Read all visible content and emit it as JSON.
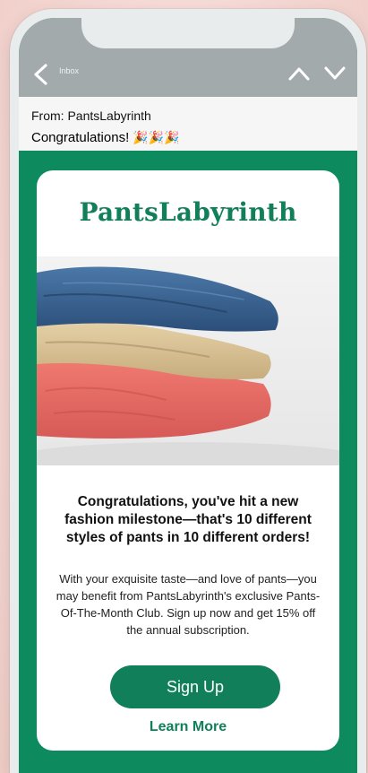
{
  "app": {
    "topbar": {
      "inbox_label": "Inbox"
    },
    "icons": {
      "back": "chevron-left-icon",
      "prev": "chevron-up-icon",
      "next": "chevron-down-icon"
    }
  },
  "email": {
    "from": "From: PantsLabyrinth",
    "subject": "Congratulations!",
    "subject_emoji": "🎉🎉🎉"
  },
  "content": {
    "brand": "PantsLabyrinth",
    "hero_alt": "Stacked folded pants: blue, beige, and coral",
    "headline": "Congratulations, you've hit a new fashion milestone—that's 10 different styles of pants in 10 different orders!",
    "body": "With your exquisite taste—and love of pants—you may benefit from PantsLabyrinth's exclusive Pants-Of-The-Month Club. Sign up now and get 15% off the annual subscription.",
    "cta_label": "Sign Up",
    "secondary_link": "Learn More"
  },
  "colors": {
    "brand_green": "#11805a",
    "email_bg_green": "#0e8a5f",
    "topbar_gray": "#a3aaac"
  }
}
